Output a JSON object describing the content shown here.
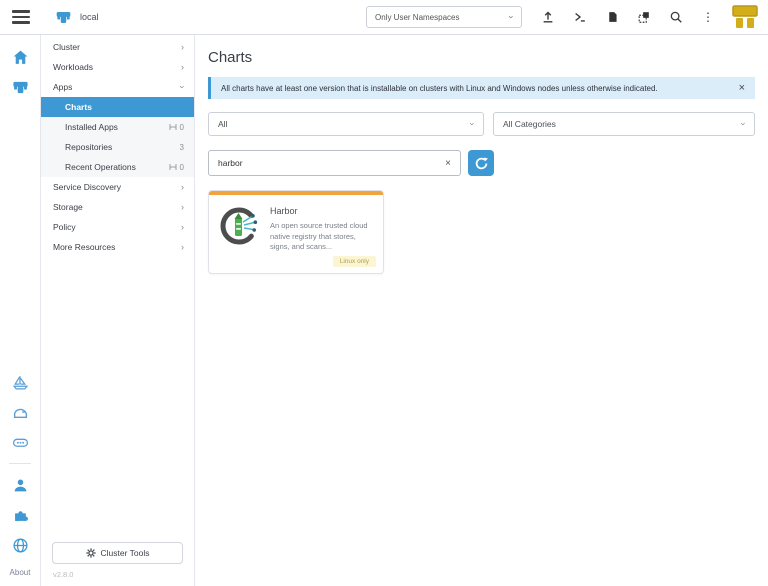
{
  "topbar": {
    "cluster_name": "local",
    "namespace_filter": "Only User Namespaces"
  },
  "icons": {
    "chevron_right": "›",
    "close": "×",
    "clear": "×",
    "kebab": "⋮"
  },
  "sidebar": {
    "top_items": [
      {
        "label": "Cluster"
      },
      {
        "label": "Workloads"
      },
      {
        "label": "Apps"
      }
    ],
    "apps_children": [
      {
        "label": "Charts"
      },
      {
        "label": "Installed Apps",
        "count": "0"
      },
      {
        "label": "Repositories",
        "count": "3"
      },
      {
        "label": "Recent Operations",
        "count": "0"
      }
    ],
    "bottom_items": [
      {
        "label": "Service Discovery"
      },
      {
        "label": "Storage"
      },
      {
        "label": "Policy"
      },
      {
        "label": "More Resources"
      }
    ],
    "cluster_tools_label": "Cluster Tools",
    "version": "v2.8.0",
    "about_label": "About"
  },
  "main": {
    "title": "Charts",
    "banner_text": "All charts have at least one version that is installable on clusters with Linux and Windows nodes unless otherwise indicated.",
    "filters": {
      "repo": "All",
      "category": "All Categories"
    },
    "search_value": "harbor",
    "cards": [
      {
        "title": "Harbor",
        "description": "An open source trusted cloud native registry that stores, signs, and scans...",
        "badge": "Linux only"
      }
    ]
  },
  "colors": {
    "primary": "#3D98D3",
    "banner_bg": "#DCEDFA",
    "card_accent": "#F1A33C",
    "avatar_gold": "#D3AE19",
    "badge_bg": "#FBF5D3",
    "badge_text": "#B3A04C"
  }
}
